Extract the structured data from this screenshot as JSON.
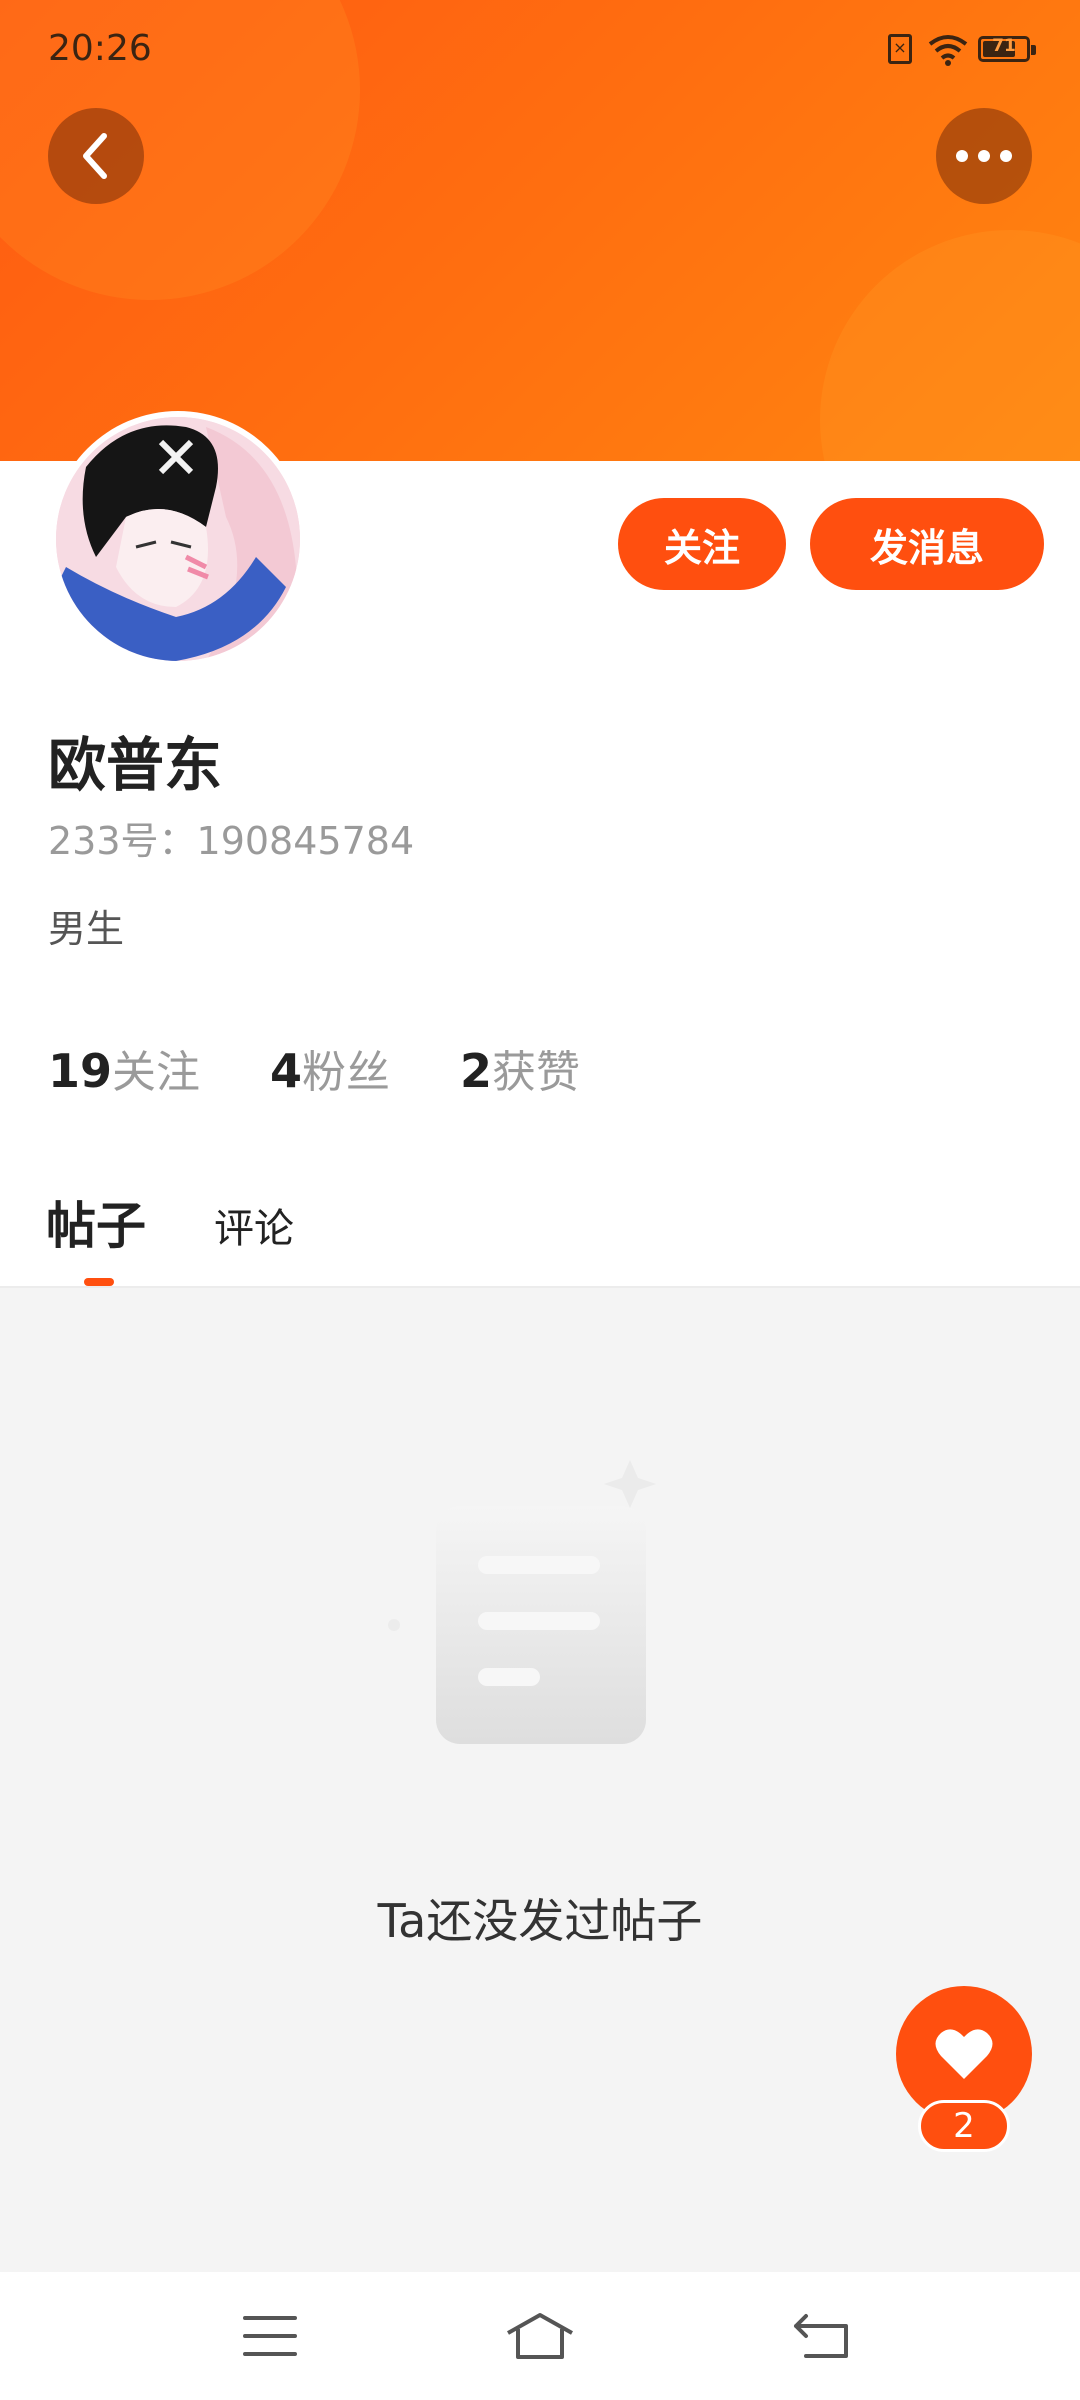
{
  "status_bar": {
    "time": "20:26",
    "battery": "71"
  },
  "header": {
    "back_icon": "chevron-left-icon",
    "more_icon": "more-dots-icon",
    "gradient_colors": [
      "#ff5a12",
      "#ff8610"
    ]
  },
  "profile": {
    "name": "欧普东",
    "uid": "233号：190845784",
    "gender": "男生",
    "follow_button": "关注",
    "message_button": "发消息"
  },
  "stats": [
    {
      "num": "19",
      "label": "关注"
    },
    {
      "num": "4",
      "label": "粉丝"
    },
    {
      "num": "2",
      "label": "获赞"
    }
  ],
  "tabs": [
    {
      "label": "帖子",
      "active": true
    },
    {
      "label": "评论",
      "active": false
    }
  ],
  "empty_state": {
    "text": "Ta还没发过帖子",
    "icon": "empty-document-icon"
  },
  "like_fab": {
    "icon": "heart-icon",
    "count": "2"
  },
  "nav_bar": {
    "icons": [
      "menu-icon",
      "home-icon",
      "back-icon"
    ]
  },
  "colors": {
    "accent": "#ff4f0f",
    "background": "#f4f4f4"
  }
}
